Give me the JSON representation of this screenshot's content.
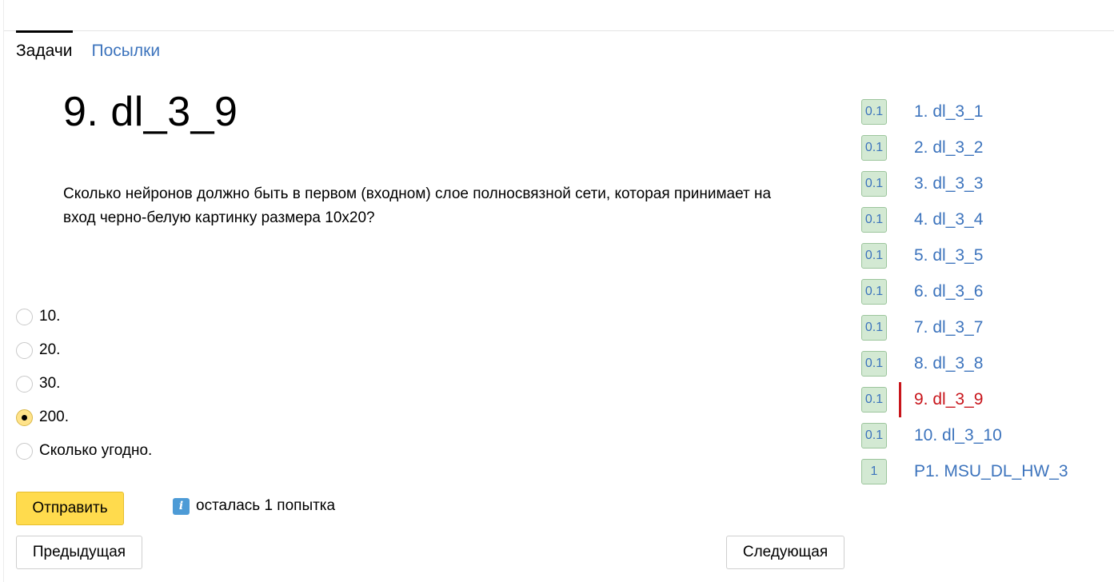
{
  "tabs": [
    {
      "label": "Задачи",
      "active": true
    },
    {
      "label": "Посылки",
      "active": false
    }
  ],
  "problem": {
    "title": "9. dl_3_9",
    "statement": "Сколько нейронов должно быть в первом (входном) слое полносвязной сети, которая принимает на вход черно-белую картинку размера 10x20?"
  },
  "options": [
    {
      "label": "10.",
      "checked": false
    },
    {
      "label": "20.",
      "checked": false
    },
    {
      "label": "30.",
      "checked": false
    },
    {
      "label": "200.",
      "checked": true
    },
    {
      "label": "Сколько угодно.",
      "checked": false
    }
  ],
  "actions": {
    "submit_label": "Отправить",
    "attempts_text": "осталась 1 попытка",
    "attempts_icon": "info-icon",
    "prev_label": "Предыдущая",
    "next_label": "Следующая"
  },
  "problem_list": [
    {
      "score": "0.1",
      "label": "1. dl_3_1"
    },
    {
      "score": "0.1",
      "label": "2. dl_3_2"
    },
    {
      "score": "0.1",
      "label": "3. dl_3_3"
    },
    {
      "score": "0.1",
      "label": "4. dl_3_4"
    },
    {
      "score": "0.1",
      "label": "5. dl_3_5"
    },
    {
      "score": "0.1",
      "label": "6. dl_3_6"
    },
    {
      "score": "0.1",
      "label": "7. dl_3_7"
    },
    {
      "score": "0.1",
      "label": "8. dl_3_8"
    },
    {
      "score": "0.1",
      "label": "9. dl_3_9",
      "current": true
    },
    {
      "score": "0.1",
      "label": "10. dl_3_10"
    },
    {
      "score": "1",
      "label": "P1. MSU_DL_HW_3"
    }
  ],
  "colors": {
    "link": "#3d74bd",
    "current": "#c8151b",
    "accent": "#ffdb4d",
    "badge_bg": "#d3e9d3"
  }
}
